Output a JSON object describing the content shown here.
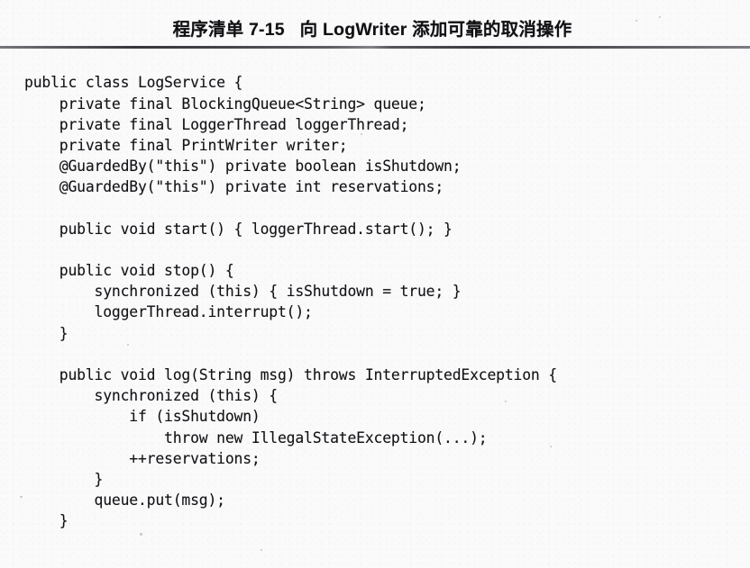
{
  "page": {
    "background_color": "#fafafb",
    "text_color": "#121215"
  },
  "caption": {
    "listing_label": "程序清单 7-15",
    "gap": "   ",
    "title": "向 LogWriter 添加可靠的取消操作",
    "full": "程序清单 7-15   向 LogWriter 添加可靠的取消操作"
  },
  "divider": {
    "name": "caption-rule",
    "color": "#3a3b3f"
  },
  "code": {
    "language": "java",
    "lines": [
      "public class LogService {",
      "    private final BlockingQueue<String> queue;",
      "    private final LoggerThread loggerThread;",
      "    private final PrintWriter writer;",
      "    @GuardedBy(\"this\") private boolean isShutdown;",
      "    @GuardedBy(\"this\") private int reservations;",
      "",
      "    public void start() { loggerThread.start(); }",
      "",
      "    public void stop() {",
      "        synchronized (this) { isShutdown = true; }",
      "        loggerThread.interrupt();",
      "    }",
      "",
      "    public void log(String msg) throws InterruptedException {",
      "        synchronized (this) {",
      "            if (isShutdown)",
      "                throw new IllegalStateException(...);",
      "            ++reservations;",
      "        }",
      "        queue.put(msg);",
      "    }"
    ]
  }
}
